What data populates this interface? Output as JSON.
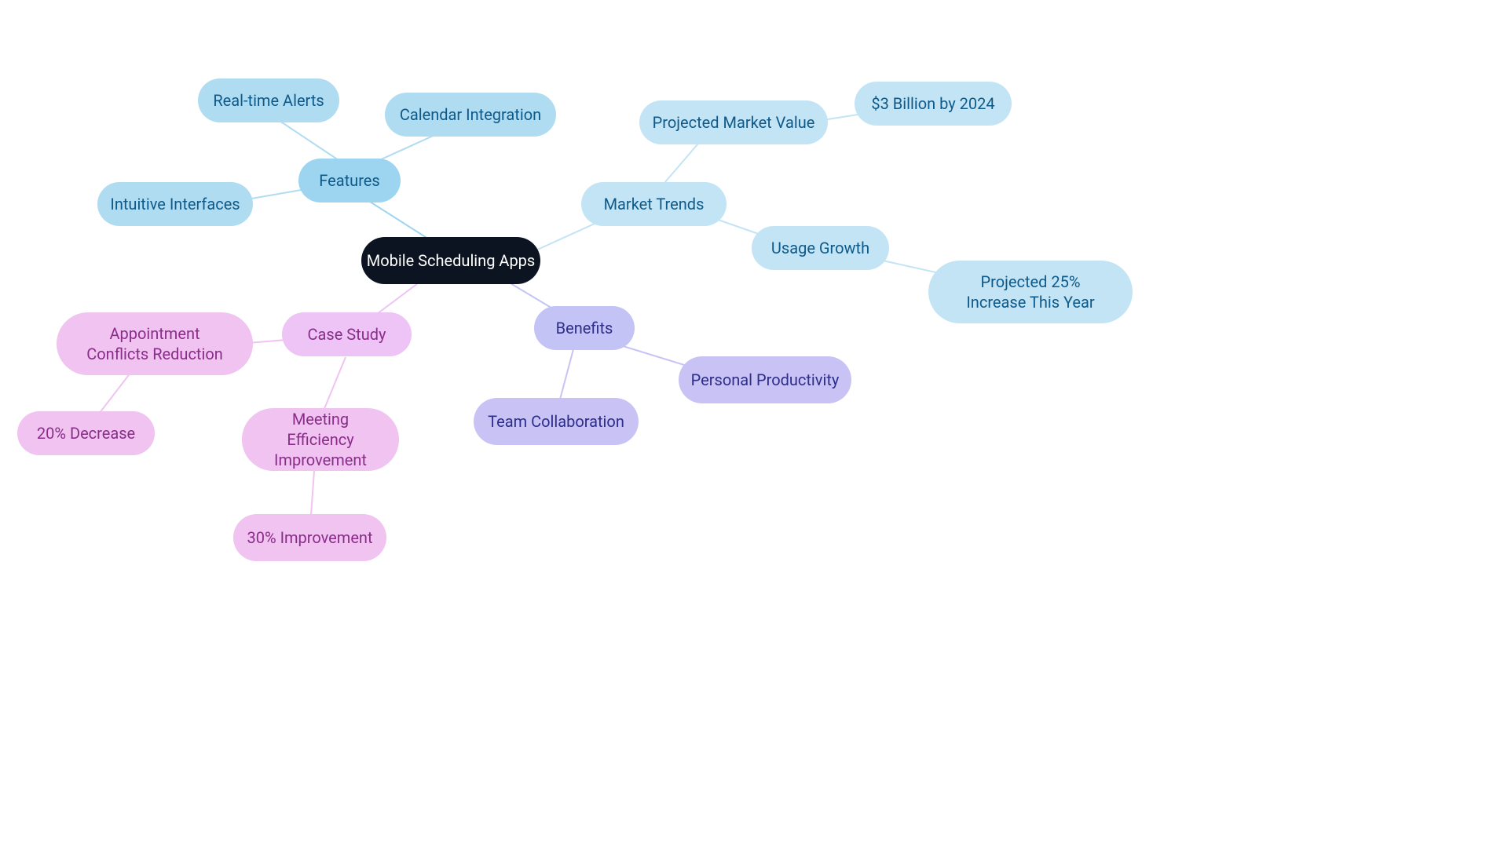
{
  "root": {
    "label": "Mobile Scheduling Apps"
  },
  "features": {
    "label": "Features",
    "children": {
      "realtime": "Real-time Alerts",
      "calendar": "Calendar Integration",
      "intuitive": "Intuitive Interfaces"
    }
  },
  "market": {
    "label": "Market Trends",
    "projected": {
      "label": "Projected Market Value",
      "value": "$3 Billion by 2024"
    },
    "usage": {
      "label": "Usage Growth",
      "value": "Projected 25% Increase This Year"
    }
  },
  "benefits": {
    "label": "Benefits",
    "team": "Team Collaboration",
    "personal": "Personal Productivity"
  },
  "case": {
    "label": "Case Study",
    "conflicts": {
      "label": "Appointment Conflicts Reduction",
      "value": "20% Decrease"
    },
    "efficiency": {
      "label": "Meeting Efficiency Improvement",
      "value": "30% Improvement"
    }
  }
}
